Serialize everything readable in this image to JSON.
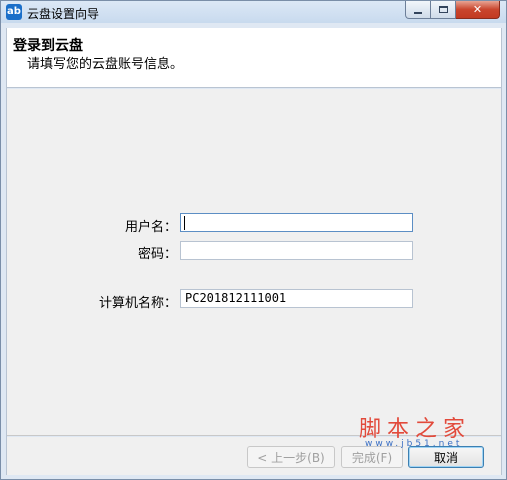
{
  "window": {
    "title": "云盘设置向导",
    "icon": "cloud-drive-app-icon",
    "icon_glyph": "ab"
  },
  "header": {
    "title": "登录到云盘",
    "subtitle": "请填写您的云盘账号信息。"
  },
  "form": {
    "username_label": "用户名：",
    "username_value": "",
    "password_label": "密码：",
    "password_value": "",
    "computer_label": "计算机名称：",
    "computer_value": "PC201812111001"
  },
  "buttons": {
    "back_label": "< 上一步(B)",
    "finish_label": "完成(F)",
    "cancel_label": "取消"
  },
  "watermark": {
    "main": "脚本之家",
    "sub": "www.jb51.net"
  },
  "colors": {
    "close_button": "#c9452d",
    "watermark_main": "#e24a3b",
    "watermark_sub": "#3a6fc4"
  }
}
